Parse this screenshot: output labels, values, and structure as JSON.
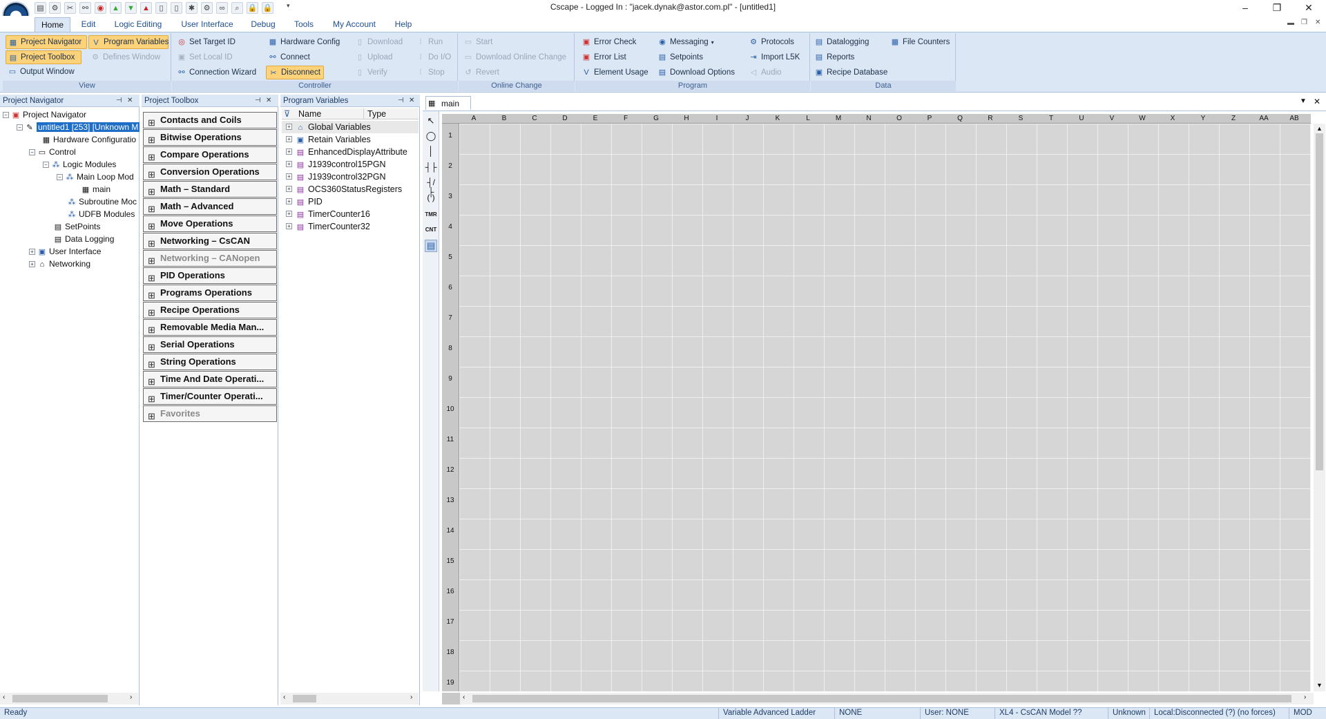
{
  "window": {
    "title": "Cscape - Logged In : \"jacek.dynak@astor.com.pl\" - [untitled1]",
    "minimize": "–",
    "restore": "❐",
    "close": "✕"
  },
  "menu": [
    "Home",
    "Edit",
    "Logic Editing",
    "User Interface",
    "Debug",
    "Tools",
    "My Account",
    "Help"
  ],
  "ribbon": {
    "view": {
      "label": "View",
      "project_navigator": "Project Navigator",
      "program_variables": "Program Variables",
      "project_toolbox": "Project Toolbox",
      "defines_window": "Defines Window",
      "output_window": "Output Window"
    },
    "controller": {
      "label": "Controller",
      "set_target_id": "Set Target  ID",
      "set_local_id": "Set Local  ID",
      "connection_wizard": "Connection Wizard",
      "hardware_config": "Hardware Config",
      "connect": "Connect",
      "disconnect": "Disconnect",
      "download": "Download",
      "upload": "Upload",
      "verify": "Verify",
      "run": "Run",
      "do_io": "Do I/O",
      "stop": "Stop"
    },
    "online_change": {
      "label": "Online Change",
      "start": "Start",
      "download_online_change": "Download Online Change",
      "revert": "Revert"
    },
    "program": {
      "label": "Program",
      "error_check": "Error Check",
      "error_list": "Error List",
      "element_usage": "Element Usage",
      "messaging": "Messaging",
      "setpoints": "Setpoints",
      "download_options": "Download Options",
      "protocols": "Protocols",
      "import_l5k": "Import  L5K",
      "audio": "Audio"
    },
    "data": {
      "label": "Data",
      "datalogging": "Datalogging",
      "reports": "Reports",
      "recipe_database": "Recipe Database",
      "file_counters": "File Counters"
    }
  },
  "navigator": {
    "title": "Project Navigator",
    "nodes": [
      "Project Navigator",
      "untitled1 [253] [Unknown M",
      "Hardware Configuratio",
      "Control",
      "Logic Modules",
      "Main Loop Mod",
      "main",
      "Subroutine Moc",
      "UDFB Modules",
      "SetPoints",
      "Data Logging",
      "User Interface",
      "Networking"
    ]
  },
  "toolbox": {
    "title": "Project Toolbox",
    "items": [
      "Contacts and Coils",
      "Bitwise Operations",
      "Compare Operations",
      "Conversion Operations",
      "Math – Standard",
      "Math – Advanced",
      "Move Operations",
      "Networking – CsCAN",
      "Networking – CANopen",
      "PID Operations",
      "Programs Operations",
      "Recipe Operations",
      "Removable Media Man...",
      "Serial Operations",
      "String Operations",
      "Time And Date Operati...",
      "Timer/Counter Operati...",
      "Favorites"
    ]
  },
  "variables": {
    "title": "Program Variables",
    "col_name": "Name",
    "col_type": "Type",
    "items": [
      "Global Variables",
      "Retain Variables",
      "EnhancedDisplayAttribute",
      "J1939control15PGN",
      "J1939control32PGN",
      "OCS360StatusRegisters",
      "PID",
      "TimerCounter16",
      "TimerCounter32"
    ]
  },
  "editor": {
    "tab": "main",
    "columns": [
      "A",
      "B",
      "C",
      "D",
      "E",
      "F",
      "G",
      "H",
      "I",
      "J",
      "K",
      "L",
      "M",
      "N",
      "O",
      "P",
      "Q",
      "R",
      "S",
      "T",
      "U",
      "V",
      "W",
      "X",
      "Y",
      "Z",
      "AA",
      "AB"
    ],
    "rows": [
      "1",
      "2",
      "3",
      "4",
      "5",
      "6",
      "7",
      "8",
      "9",
      "10",
      "11",
      "12",
      "13",
      "14",
      "15",
      "16",
      "17",
      "18",
      "19"
    ],
    "tools": [
      "TMR",
      "CNT"
    ]
  },
  "status": {
    "ready": "Ready",
    "mode": "Variable Advanced Ladder",
    "none": "NONE",
    "user": "User: NONE",
    "model": "XL4 - CsCAN Model ??",
    "unknown": "Unknown",
    "local": "Local:Disconnected (?) (no forces)",
    "mod": "MOD"
  }
}
